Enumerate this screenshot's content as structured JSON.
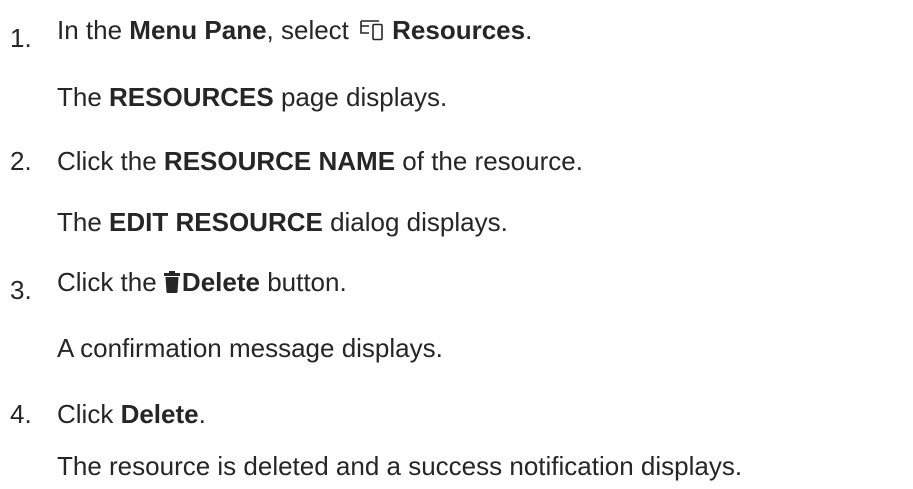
{
  "steps": [
    {
      "number": "1.",
      "instruction": {
        "pre": "In the ",
        "bold1": "Menu Pane",
        "mid": ", select ",
        "icon": "resources-icon",
        "bold2": "Resources",
        "post": "."
      },
      "result": {
        "pre": "The ",
        "bold": "RESOURCES",
        "post": " page displays."
      }
    },
    {
      "number": "2.",
      "instruction": {
        "pre": "Click the ",
        "bold": "RESOURCE NAME",
        "post": " of the resource."
      },
      "result": {
        "pre": "The ",
        "bold": "EDIT RESOURCE",
        "post": " dialog displays."
      }
    },
    {
      "number": "3.",
      "instruction": {
        "pre": "Click the ",
        "icon": "trash-icon",
        "bold": "Delete",
        "post": " button."
      },
      "result": {
        "text": "A confirmation message displays."
      }
    },
    {
      "number": "4.",
      "instruction": {
        "pre": "Click ",
        "bold": "Delete",
        "post": "."
      },
      "result": {
        "text": "The resource is deleted and a success notification displays."
      }
    }
  ]
}
